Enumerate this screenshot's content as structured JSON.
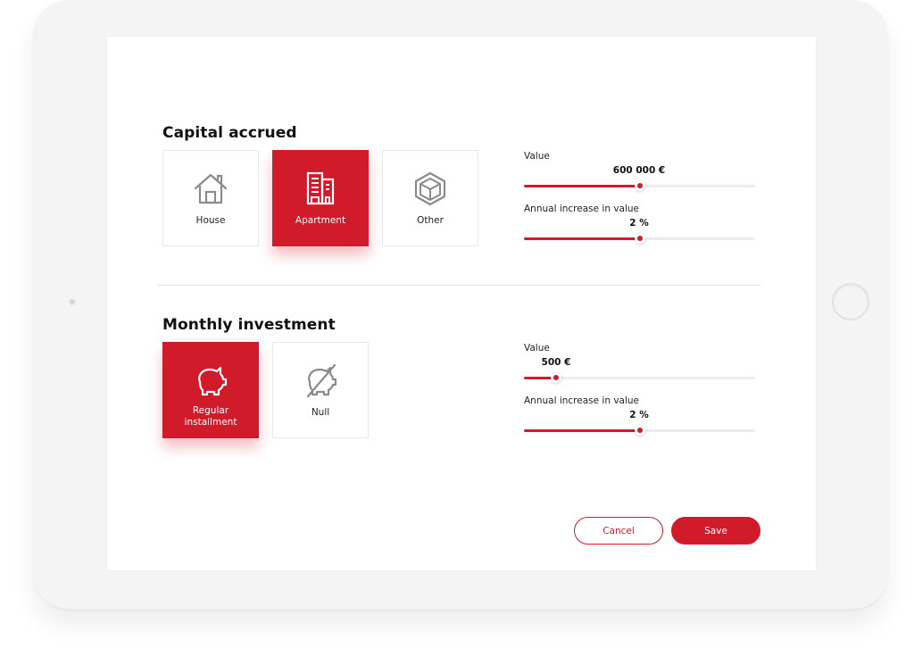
{
  "colors": {
    "accent": "#d11a2a",
    "icon_gray": "#8a8a8f",
    "frame": "#f4f4f4"
  },
  "capital": {
    "title": "Capital accrued",
    "options": [
      {
        "label": "House",
        "icon": "house-icon",
        "selected": false
      },
      {
        "label": "Apartment",
        "icon": "apartment-building-icon",
        "selected": true
      },
      {
        "label": "Other",
        "icon": "cube-icon",
        "selected": false
      }
    ],
    "sliders": [
      {
        "label": "Value",
        "display": "600 000 €",
        "fraction": 0.5
      },
      {
        "label": "Annual increase in value",
        "display": "2 %",
        "fraction": 0.5
      }
    ]
  },
  "monthly": {
    "title": "Monthly investment",
    "options": [
      {
        "label": "Regular installment",
        "icon": "piggy-bank-icon",
        "selected": true
      },
      {
        "label": "Null",
        "icon": "piggy-bank-crossed-icon",
        "selected": false
      }
    ],
    "sliders": [
      {
        "label": "Value",
        "display": "500 €",
        "fraction": 0.14
      },
      {
        "label": "Annual increase in value",
        "display": "2 %",
        "fraction": 0.5
      }
    ]
  },
  "actions": {
    "cancel_label": "Cancel",
    "save_label": "Save"
  }
}
